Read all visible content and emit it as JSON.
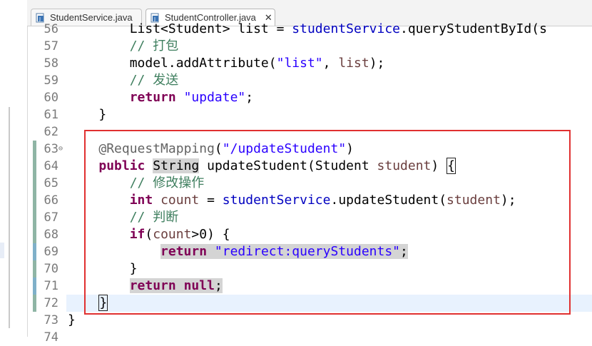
{
  "tabs": [
    {
      "label": "StudentService.java",
      "active": false
    },
    {
      "label": "StudentController.java",
      "active": true,
      "close": "✕"
    }
  ],
  "lines": [
    {
      "num": "56",
      "segments": [
        {
          "t": "        List<Student> list = ",
          "c": ""
        },
        {
          "t": "studentService",
          "c": "fld"
        },
        {
          "t": ".queryStudentById(s",
          "c": ""
        }
      ]
    },
    {
      "num": "57",
      "segments": [
        {
          "t": "        // 打包",
          "c": "cm"
        }
      ]
    },
    {
      "num": "58",
      "segments": [
        {
          "t": "        model.addAttribute(",
          "c": ""
        },
        {
          "t": "\"list\"",
          "c": "str"
        },
        {
          "t": ", ",
          "c": ""
        },
        {
          "t": "list",
          "c": "var"
        },
        {
          "t": ");",
          "c": ""
        }
      ]
    },
    {
      "num": "59",
      "segments": [
        {
          "t": "        // 发送",
          "c": "cm"
        }
      ]
    },
    {
      "num": "60",
      "segments": [
        {
          "t": "        ",
          "c": ""
        },
        {
          "t": "return",
          "c": "kw"
        },
        {
          "t": " ",
          "c": ""
        },
        {
          "t": "\"update\"",
          "c": "str"
        },
        {
          "t": ";",
          "c": ""
        }
      ]
    },
    {
      "num": "61",
      "segments": [
        {
          "t": "    }",
          "c": ""
        }
      ]
    },
    {
      "num": "62",
      "segments": []
    },
    {
      "num": "63",
      "fold": "⊖",
      "segments": [
        {
          "t": "    ",
          "c": ""
        },
        {
          "t": "@RequestMapping",
          "c": "ann"
        },
        {
          "t": "(",
          "c": ""
        },
        {
          "t": "\"/updateStudent\"",
          "c": "str"
        },
        {
          "t": ")",
          "c": ""
        }
      ]
    },
    {
      "num": "64",
      "segments": [
        {
          "t": "    ",
          "c": ""
        },
        {
          "t": "public",
          "c": "kw"
        },
        {
          "t": " ",
          "c": ""
        },
        {
          "t": "String",
          "c": "hl"
        },
        {
          "t": " updateStudent(Student ",
          "c": ""
        },
        {
          "t": "student",
          "c": "var"
        },
        {
          "t": ") ",
          "c": ""
        },
        {
          "t": "{",
          "c": "box"
        }
      ]
    },
    {
      "num": "65",
      "segments": [
        {
          "t": "        // 修改操作",
          "c": "cm"
        }
      ]
    },
    {
      "num": "66",
      "segments": [
        {
          "t": "        ",
          "c": ""
        },
        {
          "t": "int",
          "c": "kw"
        },
        {
          "t": " ",
          "c": ""
        },
        {
          "t": "count",
          "c": "var"
        },
        {
          "t": " = ",
          "c": ""
        },
        {
          "t": "studentService",
          "c": "fld"
        },
        {
          "t": ".updateStudent(",
          "c": ""
        },
        {
          "t": "student",
          "c": "var"
        },
        {
          "t": ");",
          "c": ""
        }
      ]
    },
    {
      "num": "67",
      "segments": [
        {
          "t": "        // 判断",
          "c": "cm"
        }
      ]
    },
    {
      "num": "68",
      "segments": [
        {
          "t": "        ",
          "c": ""
        },
        {
          "t": "if",
          "c": "kw"
        },
        {
          "t": "(",
          "c": ""
        },
        {
          "t": "count",
          "c": "var"
        },
        {
          "t": ">0) {",
          "c": ""
        }
      ]
    },
    {
      "num": "69",
      "segments": [
        {
          "t": "            ",
          "c": ""
        },
        {
          "t": "return",
          "c": "kw hl"
        },
        {
          "t": " ",
          "c": "hl"
        },
        {
          "t": "\"redirect:queryStudents\"",
          "c": "str hl"
        },
        {
          "t": ";",
          "c": "hl"
        }
      ]
    },
    {
      "num": "70",
      "segments": [
        {
          "t": "        }",
          "c": ""
        }
      ]
    },
    {
      "num": "71",
      "segments": [
        {
          "t": "        ",
          "c": ""
        },
        {
          "t": "return",
          "c": "kw hl"
        },
        {
          "t": " ",
          "c": "hl"
        },
        {
          "t": "null",
          "c": "kw hl"
        },
        {
          "t": ";",
          "c": "hl"
        }
      ]
    },
    {
      "num": "72",
      "current": true,
      "segments": [
        {
          "t": "    ",
          "c": ""
        },
        {
          "t": "}",
          "c": "box"
        }
      ]
    },
    {
      "num": "73",
      "segments": [
        {
          "t": "}",
          "c": ""
        }
      ]
    },
    {
      "num": "74",
      "segments": []
    }
  ],
  "colors": {
    "annotation_box": "#e03030",
    "keyword": "#7f0055",
    "string": "#2a00ff",
    "comment": "#3f7f5f",
    "field": "#0000c0",
    "variable": "#6a3e3e",
    "current_line": "#e8f2fe"
  },
  "icons": [
    "java-file-icon",
    "close-icon",
    "fold-collapse-icon"
  ]
}
